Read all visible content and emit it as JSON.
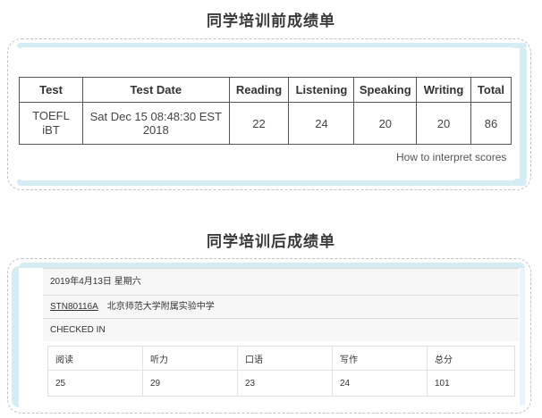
{
  "before": {
    "title": "同学培训前成绩单",
    "headers": [
      "Test",
      "Test Date",
      "Reading",
      "Listening",
      "Speaking",
      "Writing",
      "Total"
    ],
    "row": [
      "TOEFL iBT",
      "Sat Dec 15 08:48:30 EST 2018",
      "22",
      "24",
      "20",
      "20",
      "86"
    ],
    "link": "How to interpret scores"
  },
  "after": {
    "title": "同学培训后成绩单",
    "date": "2019年4月13日 星期六",
    "code": "STN80116A",
    "center": "北京师范大学附属实验中学",
    "status": "CHECKED IN",
    "headers": [
      "阅读",
      "听力",
      "口语",
      "写作",
      "总分"
    ],
    "values": [
      "25",
      "29",
      "23",
      "24",
      "101"
    ]
  },
  "colors": {
    "accent": "#d6ecf3",
    "border": "#b9c4c9"
  }
}
